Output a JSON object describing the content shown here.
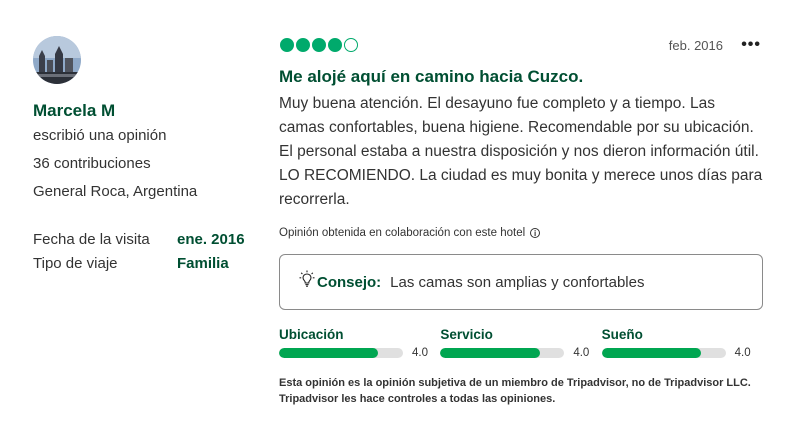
{
  "reviewer": {
    "name": "Marcela M",
    "action": "escribió una opinión",
    "contributions": "36 contribuciones",
    "location": "General Roca, Argentina"
  },
  "trip": {
    "visit_label": "Fecha de la visita",
    "visit_value": "ene. 2016",
    "type_label": "Tipo de viaje",
    "type_value": "Familia"
  },
  "review": {
    "rating": 4,
    "rating_max": 5,
    "date": "feb. 2016",
    "more_label": "•••",
    "title": "Me alojé aquí en camino hacia Cuzco.",
    "body": "Muy buena atención. El desayuno fue completo y a tiempo. Las camas confortables, buena higiene. Recomendable por su ubicación. El personal estaba a nuestra disposición y nos dieron información útil. LO RECOMIENDO. La ciudad es muy bonita y merece unos días para recorrerla.",
    "source_note": "Opinión obtenida en colaboración con este hotel",
    "info_icon": "i"
  },
  "tip": {
    "label": "Consejo:",
    "text": "Las camas son amplias y confortables",
    "icon": "lightbulb-icon"
  },
  "ratings": [
    {
      "label": "Ubicación",
      "value": "4.0",
      "fraction": 0.8
    },
    {
      "label": "Servicio",
      "value": "4.0",
      "fraction": 0.8
    },
    {
      "label": "Sueño",
      "value": "4.0",
      "fraction": 0.8
    }
  ],
  "disclaimer": "Esta opinión es la opinión subjetiva de un miembro de Tripadvisor, no de Tripadvisor LLC. Tripadvisor les hace controles a todas las opiniones.",
  "colors": {
    "brand_green": "#004f32",
    "bubble_green": "#00aa6c",
    "bar_green": "#00a651",
    "bar_track": "#e0e0e0"
  }
}
